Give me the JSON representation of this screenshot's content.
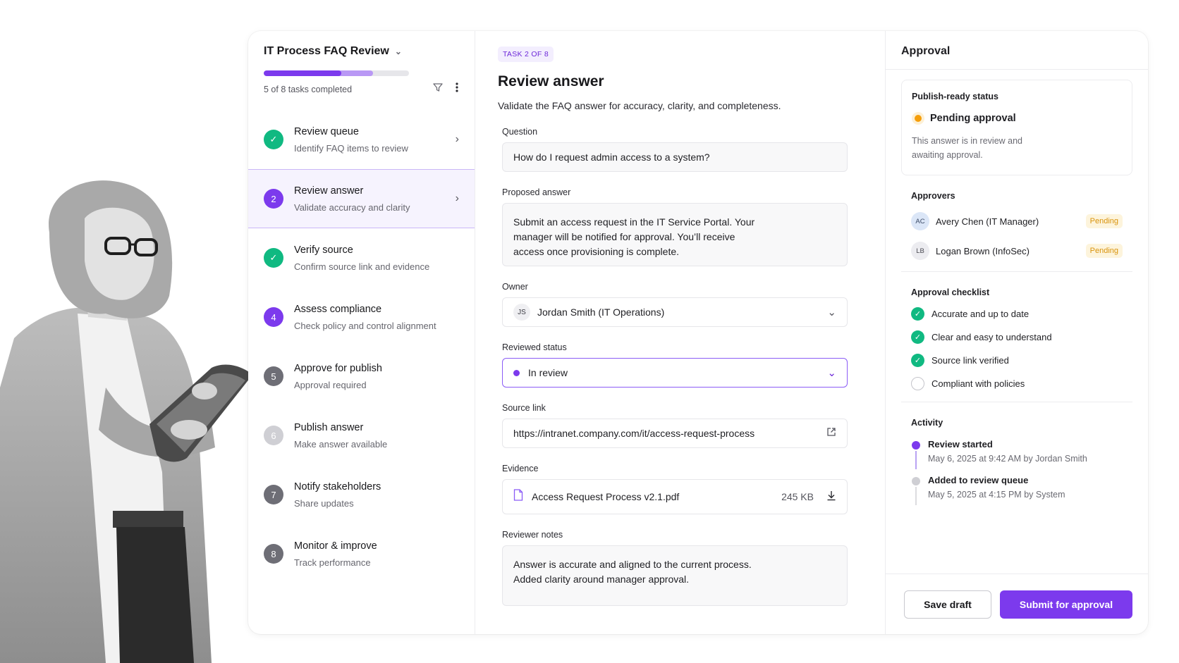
{
  "project": {
    "title": "IT Process FAQ Review",
    "progress_label": "5 of 8 tasks completed",
    "progress": 0.63
  },
  "tasks": [
    {
      "number": "",
      "state": "done",
      "title": "Review queue",
      "subtitle": "Identify FAQ items to review"
    },
    {
      "number": "2",
      "state": "current",
      "title": "Review answer",
      "subtitle": "Validate accuracy and clarity"
    },
    {
      "number": "",
      "state": "done",
      "title": "Verify source",
      "subtitle": "Confirm source link and evidence"
    },
    {
      "number": "4",
      "state": "current-num",
      "title": "Assess compliance",
      "subtitle": "Check policy and control alignment"
    },
    {
      "number": "5",
      "state": "step",
      "title": "Approve for publish",
      "subtitle": "Approval required"
    },
    {
      "number": "6",
      "state": "light",
      "title": "Publish answer",
      "subtitle": "Make answer available"
    },
    {
      "number": "7",
      "state": "step",
      "title": "Notify stakeholders",
      "subtitle": "Share updates"
    },
    {
      "number": "8",
      "state": "step",
      "title": "Monitor & improve",
      "subtitle": "Track performance"
    }
  ],
  "main": {
    "badge": "TASK 2 OF 8",
    "title": "Review answer",
    "description": "Validate the FAQ answer for accuracy, clarity, and completeness.",
    "question_label": "Question",
    "question_value": "How do I request admin access to a system?",
    "answer_label": "Proposed answer",
    "answer_value": "Submit an access request in the IT Service Portal. Your manager will be notified for approval. You’ll receive access once provisioning is complete.",
    "owner_label": "Owner",
    "owner_initials": "JS",
    "owner_value": "Jordan Smith (IT Operations)",
    "status_label": "Reviewed status",
    "status_value": "In review",
    "source_label": "Source link",
    "source_value": "https://intranet.company.com/it/access-request-process",
    "evidence_label": "Evidence",
    "evidence_file": "Access Request Process v2.1.pdf",
    "evidence_size": "245 KB",
    "notes_label": "Reviewer notes",
    "notes_line1": "Answer is accurate and aligned to the current process.",
    "notes_line2": "Added clarity around manager approval."
  },
  "approval": {
    "header": "Approval",
    "status_title": "Publish-ready status",
    "status_value": "Pending approval",
    "status_desc": "This answer is in review and awaiting approval.",
    "approvers_title": "Approvers",
    "approvers": [
      {
        "initials": "AC",
        "name": "Avery Chen (IT Manager)",
        "status": "Pending"
      },
      {
        "initials": "LB",
        "name": "Logan Brown (InfoSec)",
        "status": "Pending"
      }
    ],
    "checklist_title": "Approval checklist",
    "checklist": [
      {
        "label": "Accurate and up to date",
        "checked": true
      },
      {
        "label": "Clear and easy to understand",
        "checked": true
      },
      {
        "label": "Source link verified",
        "checked": true
      },
      {
        "label": "Compliant with policies",
        "checked": false
      }
    ],
    "activity_title": "Activity",
    "activity": [
      {
        "title": "Review started",
        "detail": "May 6, 2025 at 9:42 AM by Jordan Smith"
      },
      {
        "title": "Added to review queue",
        "detail": "May 5, 2025 at 4:15 PM by System"
      }
    ],
    "save_label": "Save draft",
    "submit_label": "Submit for approval"
  },
  "colors": {
    "accent": "#7c3aed",
    "success": "#10b981",
    "warning": "#f59e0b"
  }
}
